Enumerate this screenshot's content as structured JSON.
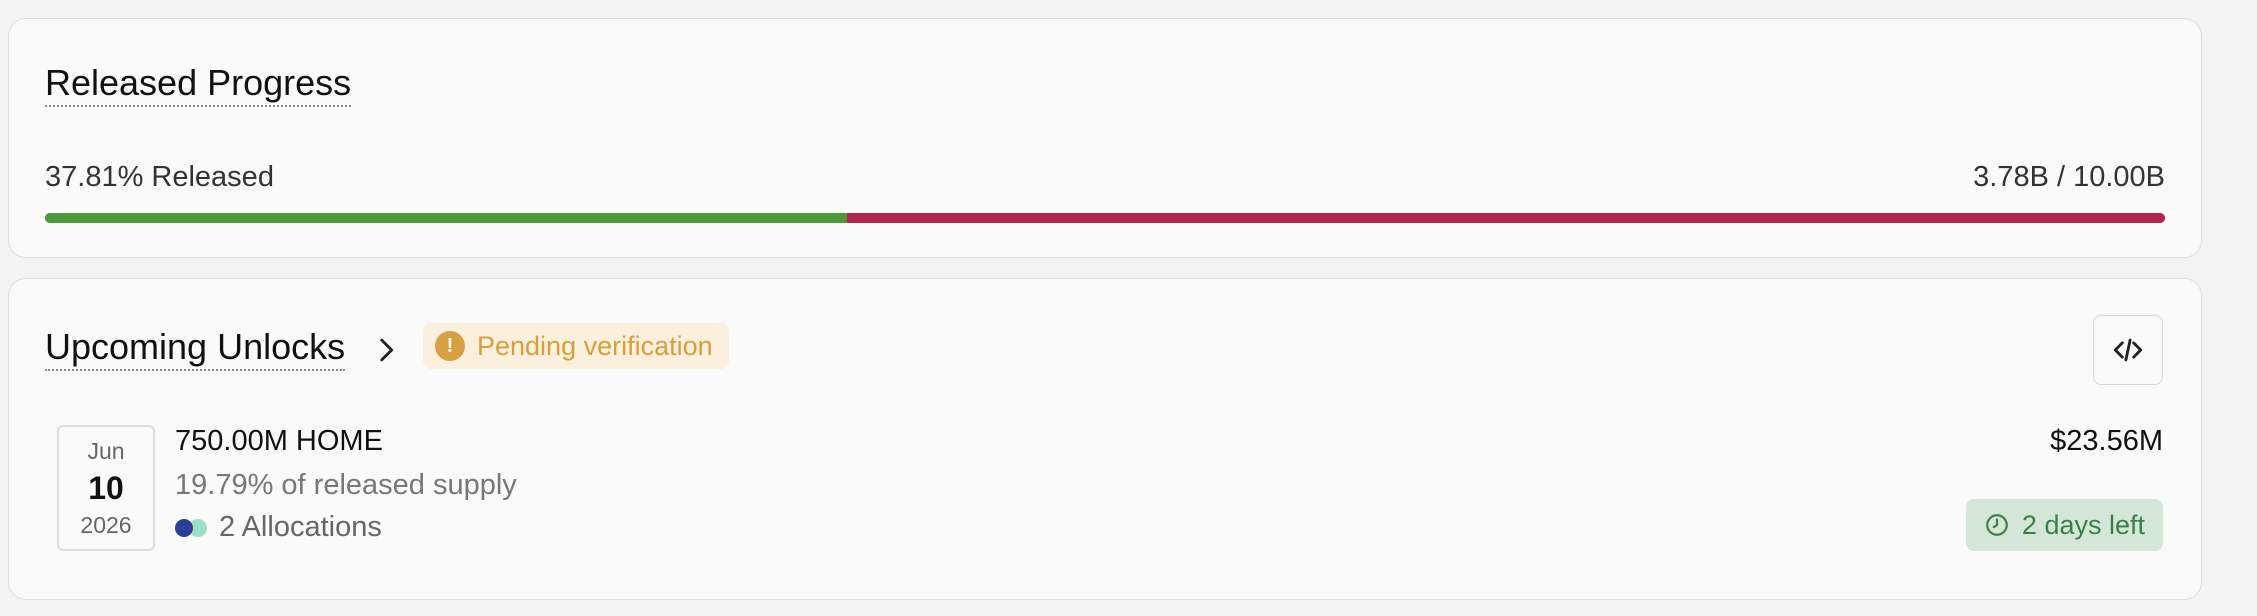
{
  "progress": {
    "title": "Released Progress",
    "percent_label": "37.81% Released",
    "percent": 37.81,
    "total_label": "3.78B / 10.00B",
    "released_color": "#4a9a3a",
    "locked_color": "#b2244e"
  },
  "unlocks": {
    "title": "Upcoming Unlocks",
    "title_icon": "chevron-right-icon",
    "badge": {
      "label": "Pending verification",
      "icon": "exclamation-icon",
      "color": "#d4a03a"
    },
    "embed_icon": "code-icon",
    "items": [
      {
        "month": "Jun",
        "day": "10",
        "year": "2026",
        "amount": "750.00M HOME",
        "supply_note": "19.79% of released supply",
        "allocations": "2 Allocations",
        "allocation_colors": [
          "#27419a",
          "#9fe0c4"
        ],
        "value": "$23.56M",
        "time_left": "2 days left",
        "time_icon": "clock-icon"
      }
    ]
  }
}
